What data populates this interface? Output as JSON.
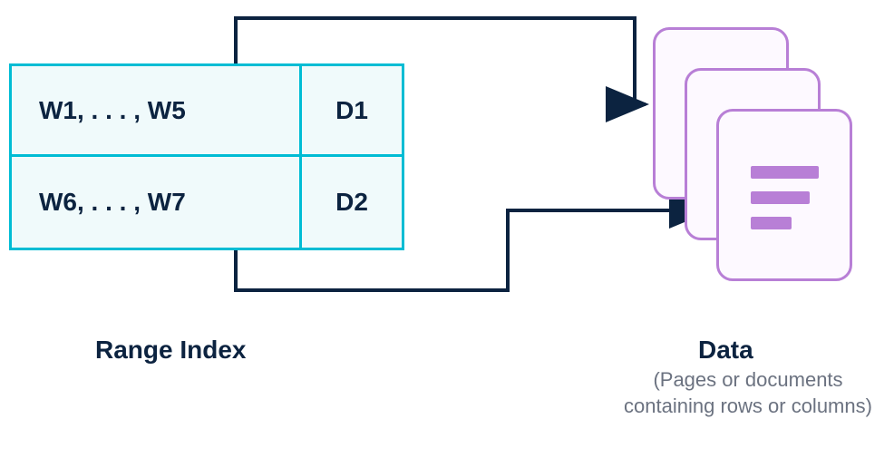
{
  "rangeIndex": {
    "label": "Range Index",
    "rows": [
      {
        "range": "W1,  . . . , W5",
        "doc": "D1"
      },
      {
        "range": "W6,  . . . , W7",
        "doc": "D2"
      }
    ]
  },
  "data": {
    "label": "Data",
    "sublabel": "(Pages or documents containing rows or columns)"
  },
  "colors": {
    "tableBorder": "#00bcd4",
    "tableBg": "#f0fafb",
    "text": "#0c2340",
    "subtext": "#6b7280",
    "docBorder": "#b87fd6",
    "docBg": "#fdf9ff",
    "arrow": "#0c2340"
  }
}
